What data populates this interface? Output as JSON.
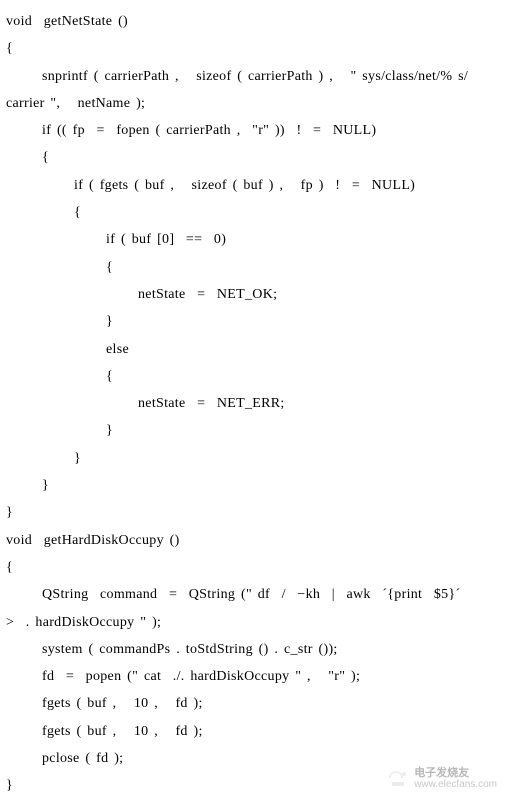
{
  "code": {
    "lines": [
      {
        "cls": "",
        "text": "void  getNetState ()"
      },
      {
        "cls": "",
        "text": "{"
      },
      {
        "cls": "i1",
        "text": "snprintf ( carrierPath ,   sizeof ( carrierPath ) ,   \" sys/class/net/% s/"
      },
      {
        "cls": "",
        "text": "carrier \",   netName );"
      },
      {
        "cls": "i1",
        "text": "if (( fp  =  fopen ( carrierPath ,  \"r\" ))  !  =  NULL)"
      },
      {
        "cls": "i1",
        "text": "{"
      },
      {
        "cls": "i2",
        "text": "if ( fgets ( buf ,   sizeof ( buf ) ,   fp )  !  =  NULL)"
      },
      {
        "cls": "i2",
        "text": "{"
      },
      {
        "cls": "i3",
        "text": "if ( buf [0]  ==  0)"
      },
      {
        "cls": "i3",
        "text": "{"
      },
      {
        "cls": "i4",
        "text": "netState  =  NET_OK;"
      },
      {
        "cls": "i3",
        "text": "}"
      },
      {
        "cls": "i3",
        "text": "else"
      },
      {
        "cls": "i3",
        "text": "{"
      },
      {
        "cls": "i4",
        "text": "netState  =  NET_ERR;"
      },
      {
        "cls": "i3",
        "text": "}"
      },
      {
        "cls": "i2",
        "text": "}"
      },
      {
        "cls": "i1",
        "text": "}"
      },
      {
        "cls": "",
        "text": "}"
      },
      {
        "cls": "",
        "text": "void  getHardDiskOccupy ()"
      },
      {
        "cls": "",
        "text": "{"
      },
      {
        "cls": "i1",
        "text": "QString  command  =  QString (\" df  /  −kh  |  awk  ´{print  $5}´"
      },
      {
        "cls": "",
        "text": ">  . hardDiskOccupy \" );"
      },
      {
        "cls": "i1",
        "text": "system ( commandPs . toStdString () . c_str ());"
      },
      {
        "cls": "i1",
        "text": "fd  =  popen (\" cat  ./. hardDiskOccupy \" ,   \"r\" );"
      },
      {
        "cls": "i1",
        "text": "fgets ( buf ,   10 ,   fd );"
      },
      {
        "cls": "i1",
        "text": "fgets ( buf ,   10 ,   fd );"
      },
      {
        "cls": "i1",
        "text": "pclose ( fd );"
      },
      {
        "cls": "",
        "text": "}"
      }
    ]
  },
  "watermark": {
    "cn": "电子发烧友",
    "url": "www.elecfans.com"
  }
}
